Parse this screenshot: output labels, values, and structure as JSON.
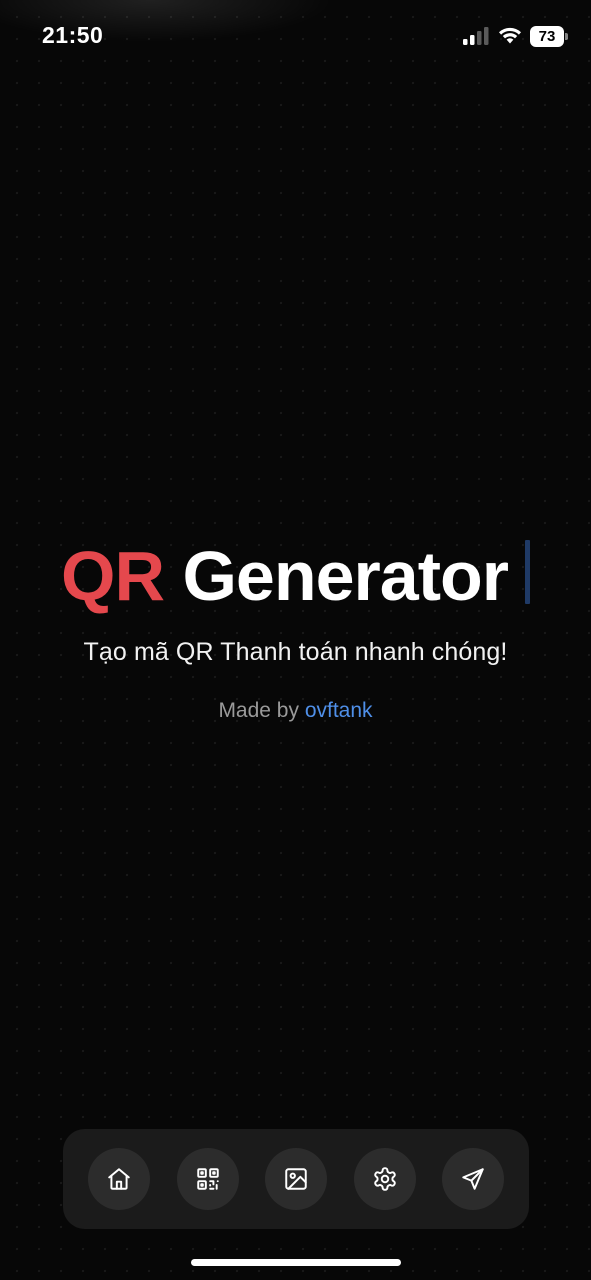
{
  "status_bar": {
    "time": "21:50",
    "battery_level": "73",
    "icons": [
      "signal-icon",
      "wifi-icon",
      "battery-icon"
    ]
  },
  "hero": {
    "title_accent": "QR",
    "title_rest": " Generator",
    "subtitle": "Tạo mã QR Thanh toán nhanh chóng!",
    "credit_prefix": "Made by ",
    "credit_author": "ovftank"
  },
  "bottom_nav": {
    "items": [
      {
        "icon": "home-icon"
      },
      {
        "icon": "qr-code-icon"
      },
      {
        "icon": "image-icon"
      },
      {
        "icon": "settings-icon"
      },
      {
        "icon": "send-icon"
      }
    ]
  },
  "colors": {
    "background": "#070707",
    "accent_red": "#e5484d",
    "link_blue": "#4f8fe8",
    "nav_bar": "#1b1b1b",
    "nav_button": "#2c2c2c",
    "caret": "#1f3a66"
  }
}
